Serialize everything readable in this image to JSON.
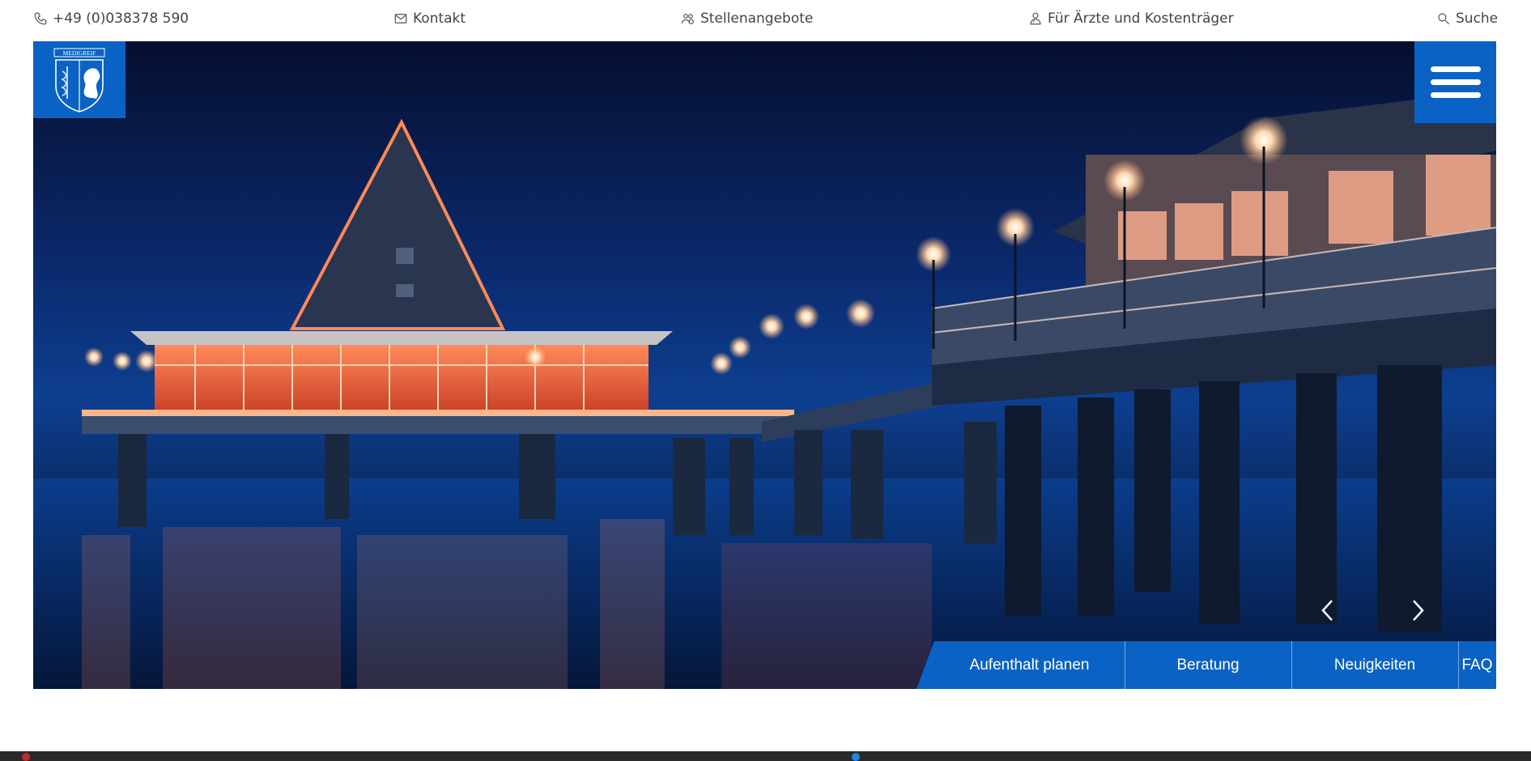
{
  "topbar": {
    "phone": "+49 (0)038378 590",
    "contact": "Kontakt",
    "jobs": "Stellenangebote",
    "doctors": "Für Ärzte und Kostenträger",
    "search": "Suche"
  },
  "logo": {
    "text": "MEDIGREIF"
  },
  "tabs": [
    {
      "label": "Aufenthalt planen"
    },
    {
      "label": "Beratung"
    },
    {
      "label": "Neuigkeiten"
    },
    {
      "label": "FAQ"
    }
  ],
  "colors": {
    "brand_blue": "#0a62c4",
    "text_gray": "#444444"
  },
  "icons": {
    "phone": "phone-icon",
    "contact": "envelope-icon",
    "jobs": "people-icon",
    "doctors": "doctor-icon",
    "search": "search-icon",
    "menu": "hamburger-icon",
    "prev": "chevron-left-icon",
    "next": "chevron-right-icon"
  }
}
